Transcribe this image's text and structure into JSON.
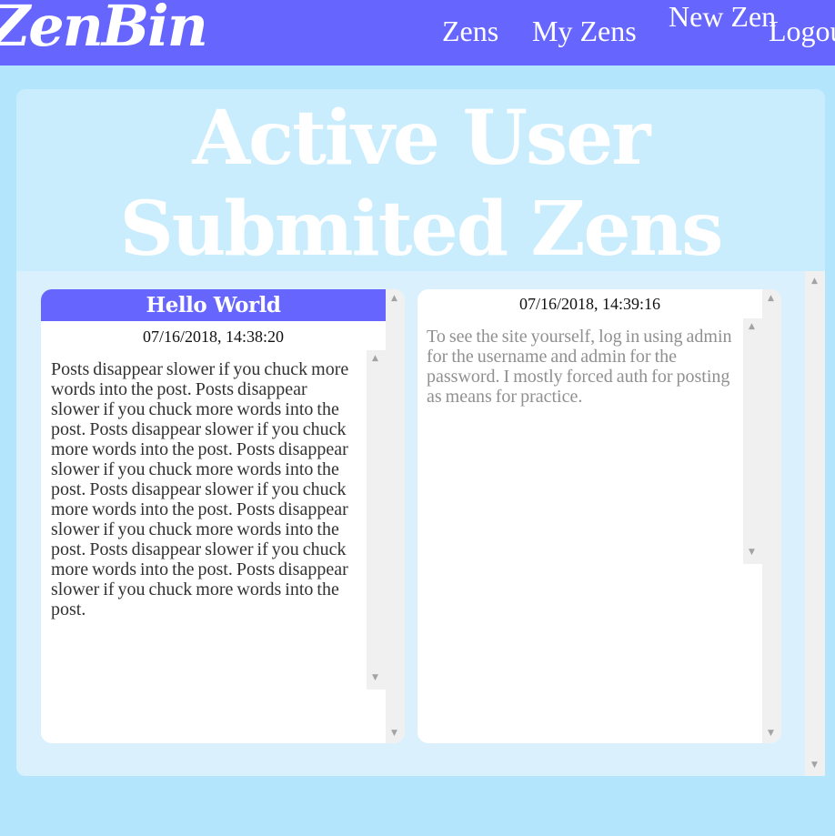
{
  "nav": {
    "logo": "ZenBin",
    "links": [
      {
        "label": "Zens"
      },
      {
        "label": "My Zens"
      },
      {
        "label": "New Zen"
      },
      {
        "label": "Logout"
      }
    ]
  },
  "page": {
    "title": "Active User Submited Zens"
  },
  "zens": [
    {
      "title": "Hello World",
      "timestamp": "07/16/2018, 14:38:20",
      "body": "Posts disappear slower if you chuck more words into the post. Posts disappear slower if you chuck more words into the post. Posts disappear slower if you chuck more words into the post. Posts disappear slower if you chuck more words into the post. Posts disappear slower if you chuck more words into the post. Posts disappear slower if you chuck more words into the post. Posts disappear slower if you chuck more words into the post. Posts disappear slower if you chuck more words into the post."
    },
    {
      "title": "",
      "timestamp": "07/16/2018, 14:39:16",
      "body": "To see the site yourself, log in using admin for the username and admin for the password. I mostly forced auth for posting as means for practice."
    }
  ],
  "colors": {
    "accent": "#6666ff",
    "background": "#b3e5fc",
    "card": "#c9edfc",
    "zens_area": "#daf1fd"
  },
  "icons": {
    "scroll_up": "scroll-up-arrow-icon",
    "scroll_down": "scroll-down-arrow-icon"
  }
}
